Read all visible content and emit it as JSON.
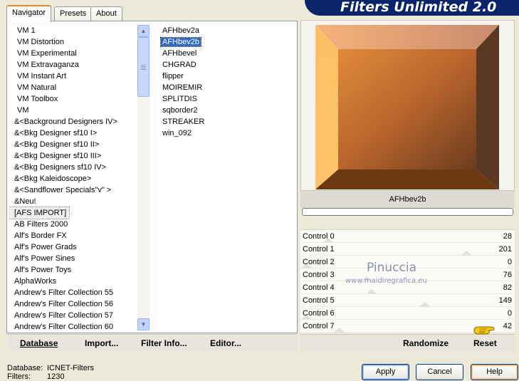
{
  "window": {
    "title": "Filters Unlimited 2.0"
  },
  "tabs": [
    {
      "label": "Navigator",
      "active": true
    },
    {
      "label": "Presets",
      "active": false
    },
    {
      "label": "About",
      "active": false
    }
  ],
  "categories": [
    {
      "label": "VM 1",
      "indent": true
    },
    {
      "label": "VM Distortion",
      "indent": true
    },
    {
      "label": "VM Experimental",
      "indent": true
    },
    {
      "label": "VM Extravaganza",
      "indent": true
    },
    {
      "label": "VM Instant Art",
      "indent": true
    },
    {
      "label": "VM Natural",
      "indent": true
    },
    {
      "label": "VM Toolbox",
      "indent": true
    },
    {
      "label": "VM",
      "indent": true
    },
    {
      "label": "&<Background Designers IV>"
    },
    {
      "label": "&<Bkg Designer sf10 I>"
    },
    {
      "label": "&<Bkg Designer sf10 II>"
    },
    {
      "label": "&<Bkg Designer sf10 III>"
    },
    {
      "label": "&<Bkg Designers sf10 IV>"
    },
    {
      "label": "&<Bkg Kaleidoscope>"
    },
    {
      "label": "&<Sandflower Specials\"v\" >"
    },
    {
      "label": "&Neu!"
    },
    {
      "label": "[AFS IMPORT]",
      "selected": true
    },
    {
      "label": "AB Filters 2000"
    },
    {
      "label": "Alf's Border FX"
    },
    {
      "label": "Alf's Power Grads"
    },
    {
      "label": "Alf's Power Sines"
    },
    {
      "label": "Alf's Power Toys"
    },
    {
      "label": "AlphaWorks"
    },
    {
      "label": "Andrew's Filter Collection 55"
    },
    {
      "label": "Andrew's Filter Collection 56"
    },
    {
      "label": "Andrew's Filter Collection 57"
    },
    {
      "label": "Andrew's Filter Collection 60"
    }
  ],
  "scrollbar": {
    "up_arrow": "▲",
    "down_arrow": "▼"
  },
  "filters": [
    {
      "label": "AFHbev2a"
    },
    {
      "label": "AFHbev2b",
      "selected": true
    },
    {
      "label": "AFHbevel"
    },
    {
      "label": "CHGRAD"
    },
    {
      "label": "flipper"
    },
    {
      "label": "MOIREMIR"
    },
    {
      "label": "SPLITDIS"
    },
    {
      "label": "sqborder2"
    },
    {
      "label": "STREAKER"
    },
    {
      "label": "win_092"
    }
  ],
  "preview": {
    "filter_name": "AFHbev2b",
    "progress": 0,
    "colors": {
      "top": "#f7b27a",
      "left": "#fec36a",
      "right": "#5b3822",
      "bottom": "#6b3a12",
      "center": "#b8642c"
    }
  },
  "controls": [
    {
      "label": "Control 0",
      "value": "28",
      "level": 28
    },
    {
      "label": "Control 1",
      "value": "201",
      "level": 201
    },
    {
      "label": "Control 2",
      "value": "0",
      "level": 0
    },
    {
      "label": "Control 3",
      "value": "76",
      "level": 76
    },
    {
      "label": "Control 4",
      "value": "82",
      "level": 82
    },
    {
      "label": "Control 5",
      "value": "149",
      "level": 149
    },
    {
      "label": "Control 6",
      "value": "0",
      "level": 0
    },
    {
      "label": "Control 7",
      "value": "42",
      "level": 42
    }
  ],
  "watermark": {
    "title": "Pinuccia",
    "url": "www.maidiregrafica.eu"
  },
  "toolbar": {
    "database": "Database",
    "import": "Import...",
    "filter_info": "Filter Info...",
    "editor": "Editor...",
    "randomize": "Randomize",
    "reset": "Reset"
  },
  "status": {
    "database_label": "Database:",
    "database_value": "ICNET-Filters",
    "filters_label": "Filters:",
    "filters_value": "1230"
  },
  "buttons": {
    "apply": "Apply",
    "cancel": "Cancel",
    "help": "Help"
  }
}
